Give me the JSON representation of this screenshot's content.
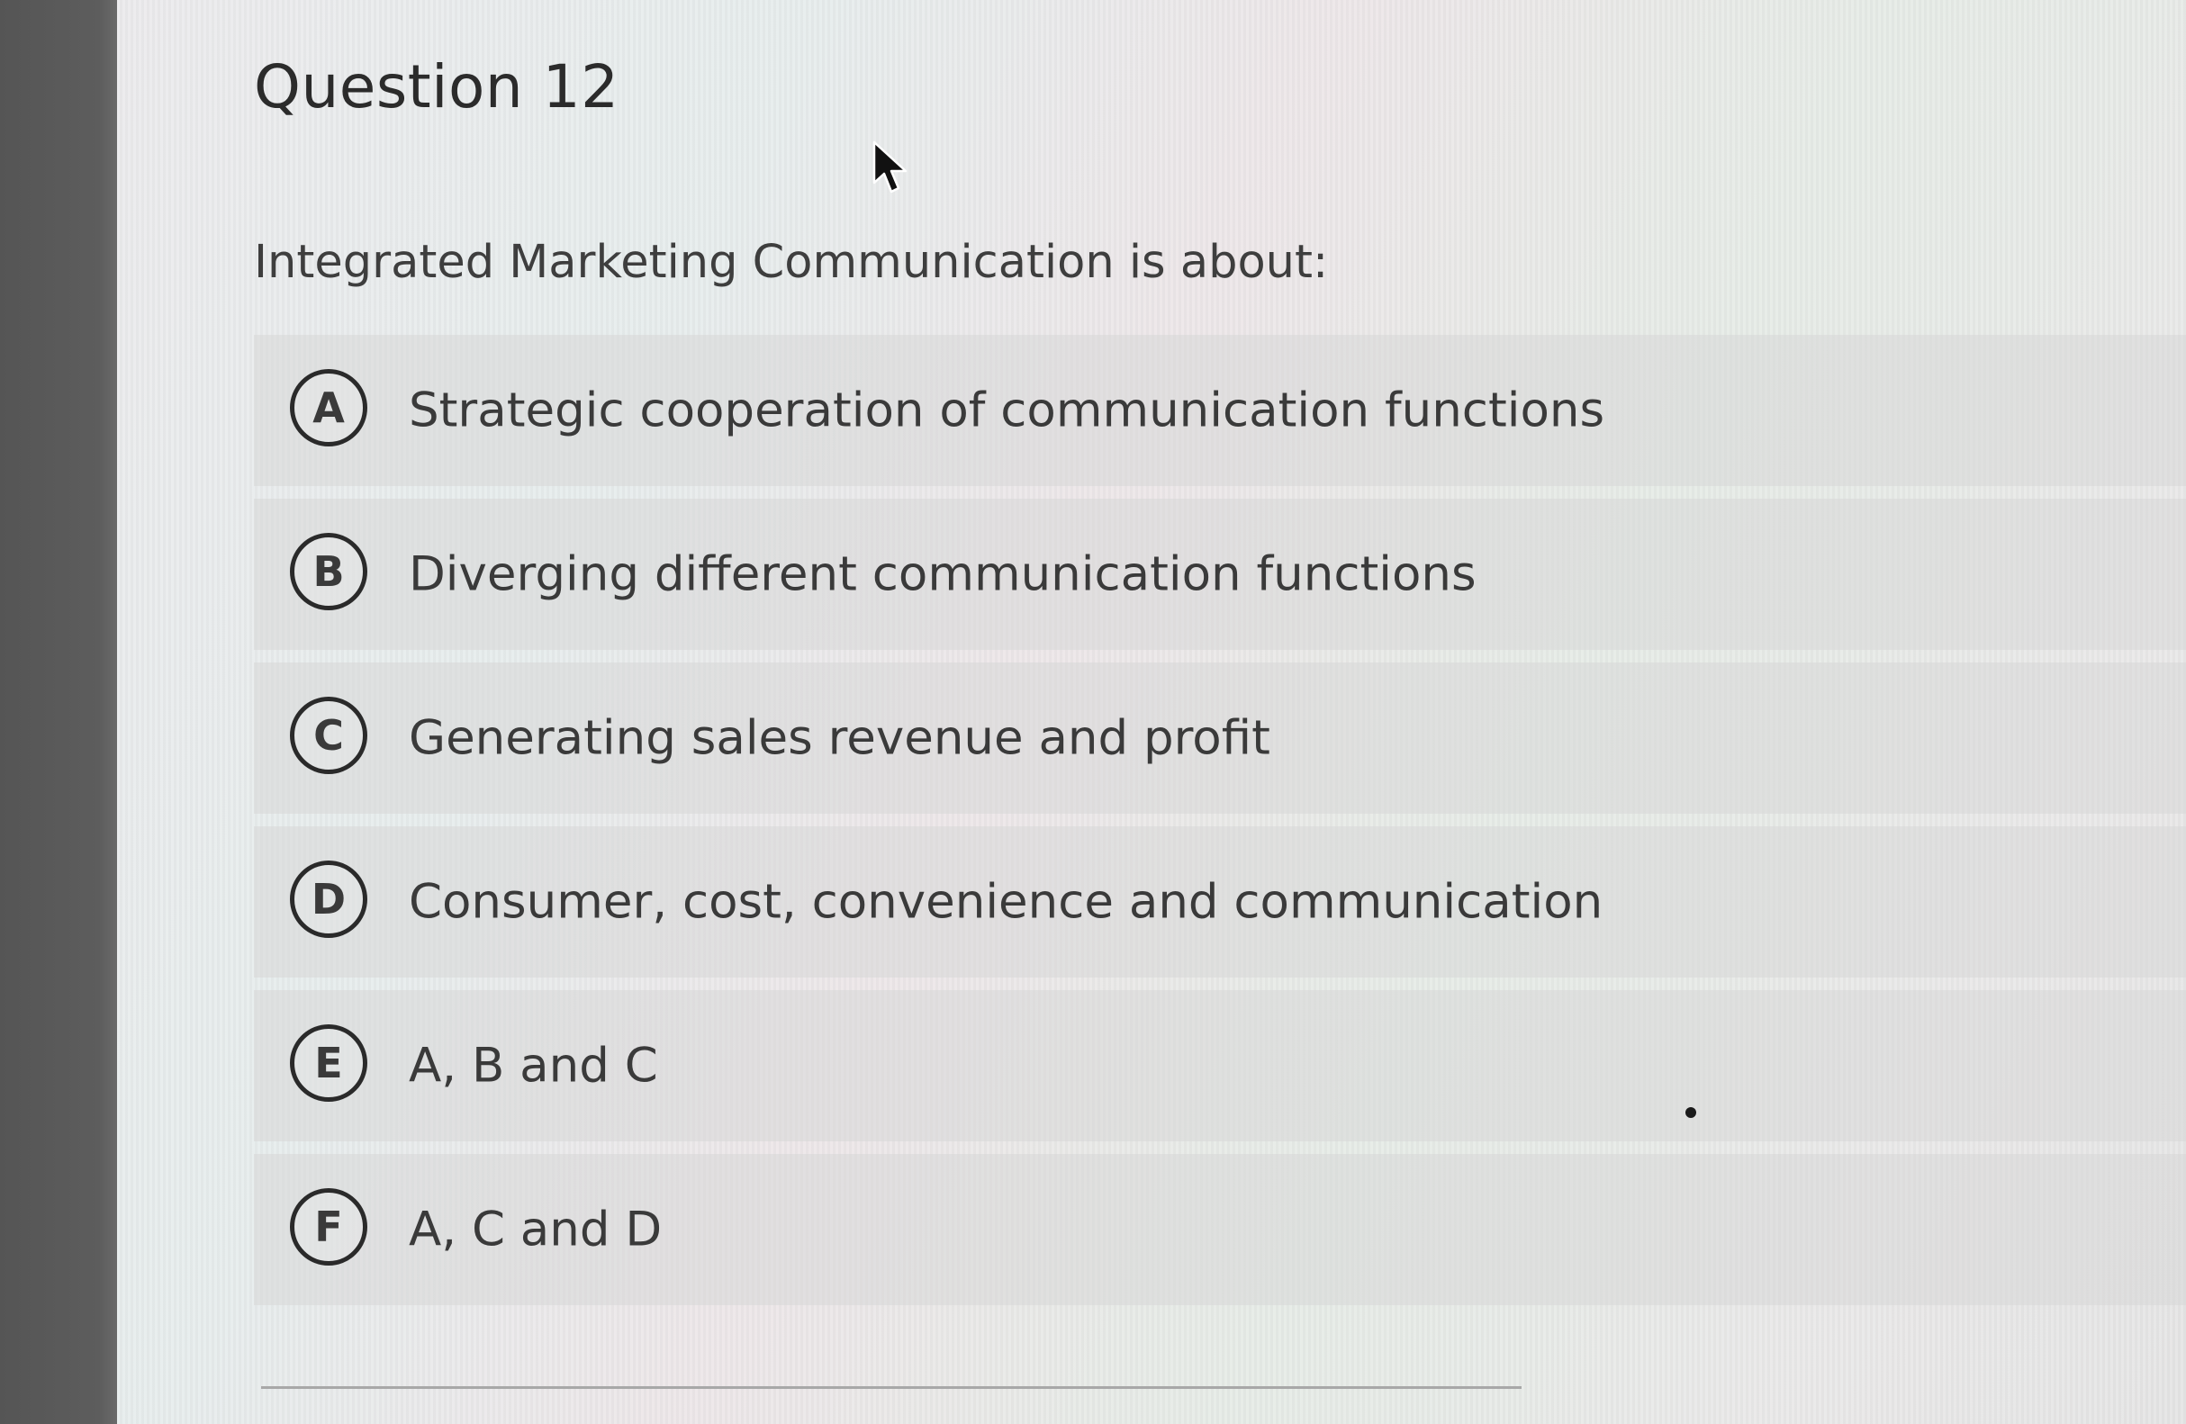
{
  "question": {
    "title": "Question 12",
    "prompt": "Integrated Marketing Communication is about:"
  },
  "options": [
    {
      "letter": "A",
      "text": "Strategic cooperation of communication functions"
    },
    {
      "letter": "B",
      "text": "Diverging different communication functions"
    },
    {
      "letter": "C",
      "text": "Generating sales revenue and profit"
    },
    {
      "letter": "D",
      "text": "Consumer, cost, convenience and communication"
    },
    {
      "letter": "E",
      "text": "A, B and C"
    },
    {
      "letter": "F",
      "text": "A, C and D"
    }
  ],
  "icons": {
    "cursor": "mouse-pointer-icon"
  },
  "colors": {
    "left_bar": "#555555",
    "page_background": "#e8e8e8",
    "option_background": "#d7d7d7",
    "text": "#3a3a3a"
  }
}
